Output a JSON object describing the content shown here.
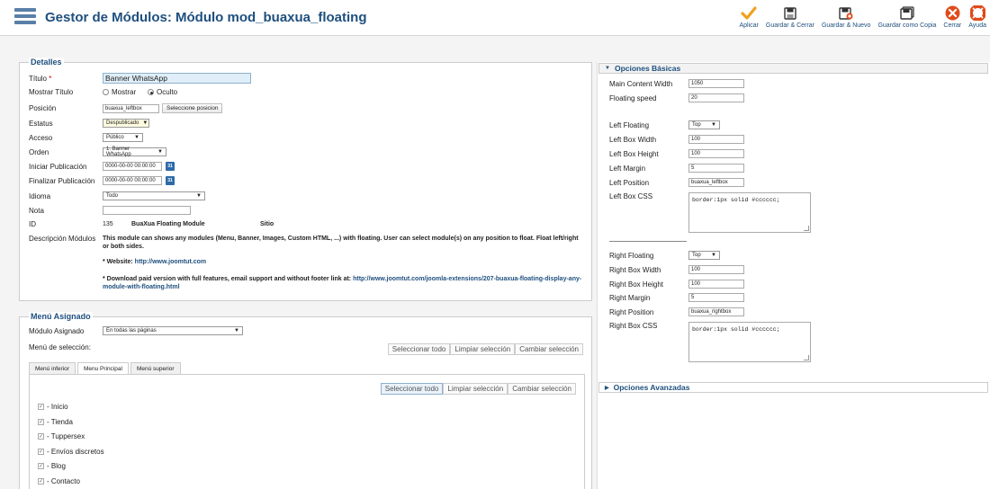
{
  "header": {
    "title": "Gestor de Módulos: Módulo mod_buaxua_floating",
    "toolbar": [
      {
        "label": "Aplicar",
        "icon": "apply-icon"
      },
      {
        "label": "Guardar & Cerrar",
        "icon": "save-close-icon"
      },
      {
        "label": "Guardar & Nuevo",
        "icon": "save-new-icon"
      },
      {
        "label": "Guardar como Copia",
        "icon": "save-copy-icon"
      },
      {
        "label": "Cerrar",
        "icon": "close-icon"
      },
      {
        "label": "Ayuda",
        "icon": "help-icon"
      }
    ]
  },
  "details": {
    "legend": "Detalles",
    "title_label": "Título",
    "title_required": "*",
    "title_value": "Banner WhatsApp",
    "show_title_label": "Mostrar Título",
    "show_option": "Mostrar",
    "hide_option": "Oculto",
    "position_label": "Posición",
    "position_value": "buaxua_leftbox",
    "position_button": "Seleccione posicion",
    "status_label": "Estatus",
    "status_value": "Despublicado",
    "access_label": "Acceso",
    "access_value": "Público",
    "order_label": "Orden",
    "order_value": "1. Banner WhatsApp",
    "start_label": "Iniciar Publicación",
    "start_value": "0000-00-00 00:00:00",
    "end_label": "Finalizar Publicación",
    "end_value": "0000-00-00 00:00:00",
    "calendar_text": "31",
    "language_label": "Idioma",
    "language_value": "Todo",
    "note_label": "Nota",
    "note_value": "",
    "id_label": "ID",
    "id_value": "135",
    "module_name": "BuaXua Floating Module",
    "site_label": "Sitio",
    "desc_label": "Descripción Módulos",
    "desc_text": "This module can shows any modules (Menu, Banner, Images, Custom HTML, ...) with floating. User can select module(s) on any position to float. Float left/right or both sides.",
    "website_prefix": "* Website:",
    "website_link": "http://www.joomtut.com",
    "download_prefix": "* Download paid version with full features, email support and without footer link at:",
    "download_link": "http://www.joomtut.com/joomla-extensions/207-buaxua-floating-display-any-module-with-floating.html"
  },
  "menu": {
    "legend": "Menú Asignado",
    "module_assign_label": "Módulo Asignado",
    "module_assign_value": "En todas las páginas",
    "selection_label": "Menú de selección:",
    "btn_select_all": "Seleccionar todo",
    "btn_clear": "Limpiar selección",
    "btn_toggle": "Cambiar selección",
    "tabs": [
      "Menú inferior",
      "Menu Principal",
      "Menú superior"
    ],
    "items": [
      "- Inicio",
      "- Tienda",
      "- Tuppersex",
      "- Envíos discretos",
      "- Blog",
      "- Contacto"
    ]
  },
  "basic": {
    "header": "Opciones Básicas",
    "main_width_label": "Main Content Width",
    "main_width_value": "1050",
    "floating_speed_label": "Floating speed",
    "floating_speed_value": "20",
    "left_floating_label": "Left Floating",
    "left_floating_value": "Top",
    "left_width_label": "Left Box Width",
    "left_width_value": "100",
    "left_height_label": "Left Box Height",
    "left_height_value": "100",
    "left_margin_label": "Left Margin",
    "left_margin_value": "5",
    "left_position_label": "Left Position",
    "left_position_value": "buaxua_leftbox",
    "left_css_label": "Left Box CSS",
    "left_css_value": "border:1px solid #cccccc;",
    "right_floating_label": "Right Floating",
    "right_floating_value": "Top",
    "right_width_label": "Right Box Width",
    "right_width_value": "100",
    "right_height_label": "Right Box Height",
    "right_height_value": "100",
    "right_margin_label": "Right Margin",
    "right_margin_value": "5",
    "right_position_label": "Right Position",
    "right_position_value": "buaxua_rightbox",
    "right_css_label": "Right Box CSS",
    "right_css_value": "border:1px solid #cccccc;"
  },
  "advanced": {
    "header": "Opciones Avanzadas"
  },
  "colors": {
    "accent": "#1e4f7e",
    "apply": "#f0a020",
    "close": "#e04a1a"
  }
}
